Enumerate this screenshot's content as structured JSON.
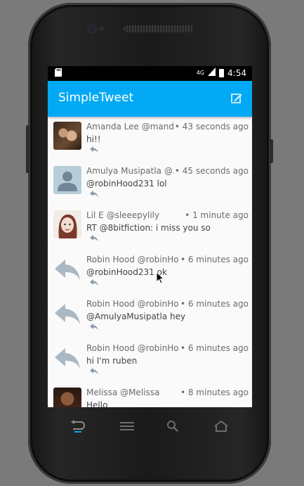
{
  "status_bar": {
    "network": "4G",
    "time": "4:54"
  },
  "app_bar": {
    "title": "SimpleTweet",
    "compose_icon": "compose-icon"
  },
  "tweets": [
    {
      "name": "Amanda Lee  @mandal",
      "time": "• 43 seconds ago",
      "text": "hi!!",
      "avatar": "photo-woman"
    },
    {
      "name": "Amulya Musipatla  @A",
      "time": "• 45 seconds ago",
      "text": "@robinHood231 lol",
      "avatar": "default-person"
    },
    {
      "name": "Lil E  @sleeepylily",
      "time": "• 1 minute ago",
      "text": "RT @8bitfiction: i miss you so",
      "avatar": "drawn-girl"
    },
    {
      "name": "Robin Hood  @robinHoo",
      "time": "• 6 minutes ago",
      "text": "@robinHood231 ok",
      "avatar": "reply-arrow"
    },
    {
      "name": "Robin Hood  @robinHoo",
      "time": "• 6 minutes ago",
      "text": "@AmulyaMusipatla hey",
      "avatar": "reply-arrow"
    },
    {
      "name": "Robin Hood  @robinHoo",
      "time": "• 6 minutes ago",
      "text": "hi I'm ruben",
      "avatar": "reply-arrow"
    },
    {
      "name": "Melissa  @Melissa",
      "time": "• 8 minutes ago",
      "text": "Hello",
      "avatar": "photo-woman-2"
    }
  ],
  "colors": {
    "accent": "#03a9f4",
    "background": "#fafafa",
    "text_secondary": "#6b6b6b"
  }
}
